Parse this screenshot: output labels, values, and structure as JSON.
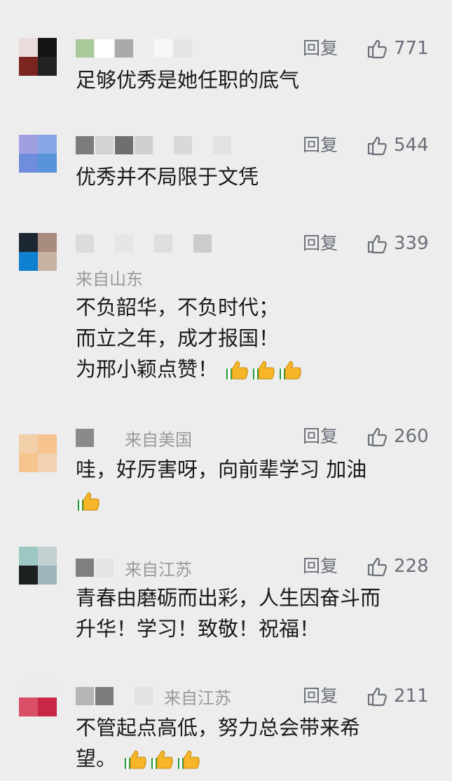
{
  "reply_label": "回复",
  "comments": [
    {
      "likes": "771",
      "lines": [
        "足够优秀是她任职的底气"
      ],
      "avatar_colors": [
        "#eadcdc",
        "#141414",
        "#7a2520",
        "#222222"
      ],
      "blur_colors": [
        "#a8c99a",
        "#ffffff",
        "#a9a9a9",
        "#ededed",
        "#f7f7f7",
        "#e5e5e5"
      ]
    },
    {
      "likes": "544",
      "lines": [
        "优秀并不局限于文凭"
      ],
      "avatar_colors": [
        "#a29fe0",
        "#87a8e8",
        "#6e8ddb",
        "#5a94d8"
      ],
      "blur_colors": [
        "#7c7c7c",
        "#d2d2d2",
        "#6f6f6f",
        "#cfcfcf",
        "#ededed",
        "#d8d8d8",
        "#ededed",
        "#e2e2e2"
      ]
    },
    {
      "likes": "339",
      "from": "来自山东",
      "lines": [
        "不负韶华，不负时代；",
        "而立之年，成才报国！",
        "为邢小颖点赞！"
      ],
      "emoji_count": 3,
      "avatar_colors": [
        "#1d2733",
        "#a88c7d",
        "#0f7fcf",
        "#c8b2a4"
      ],
      "blur_colors": [
        "#dcdcdc",
        "#ededed",
        "#e6e6e6",
        "#ededed",
        "#dedede",
        "#ededed",
        "#cccccc"
      ]
    },
    {
      "likes": "260",
      "name_from": "来自美国",
      "lines": [
        "哇，好厉害呀，向前辈学习 加油"
      ],
      "emoji_line2": 1,
      "avatar_colors": [
        "#f0cfa9",
        "#f6c28d",
        "#f6c48f",
        "#f1d2b0"
      ],
      "blur_colors": [
        "#8a8a8a",
        "#ededed"
      ]
    },
    {
      "likes": "228",
      "name_from": "来自江苏",
      "lines": [
        "青春由磨砺而出彩，人生因奋斗而",
        "升华！学习！致敬！祝福！"
      ],
      "avatar_colors": [
        "#9dc7c3",
        "#c1d2d0",
        "#1c2020",
        "#9eb7bf"
      ],
      "blur_colors": [
        "#7f7f7f",
        "#e4e4e4"
      ]
    },
    {
      "likes": "211",
      "name_from": "来自江苏",
      "lines": [
        "不管起点高低，努力总会带来希",
        "望。"
      ],
      "emoji_line2": 3,
      "avatar_colors": [
        "#ececec",
        "#ececec",
        "#d94f68",
        "#c82846"
      ],
      "blur_colors": [
        "#b5b5b5",
        "#7b7b7b",
        "#ededed",
        "#e2e2e2"
      ]
    }
  ]
}
